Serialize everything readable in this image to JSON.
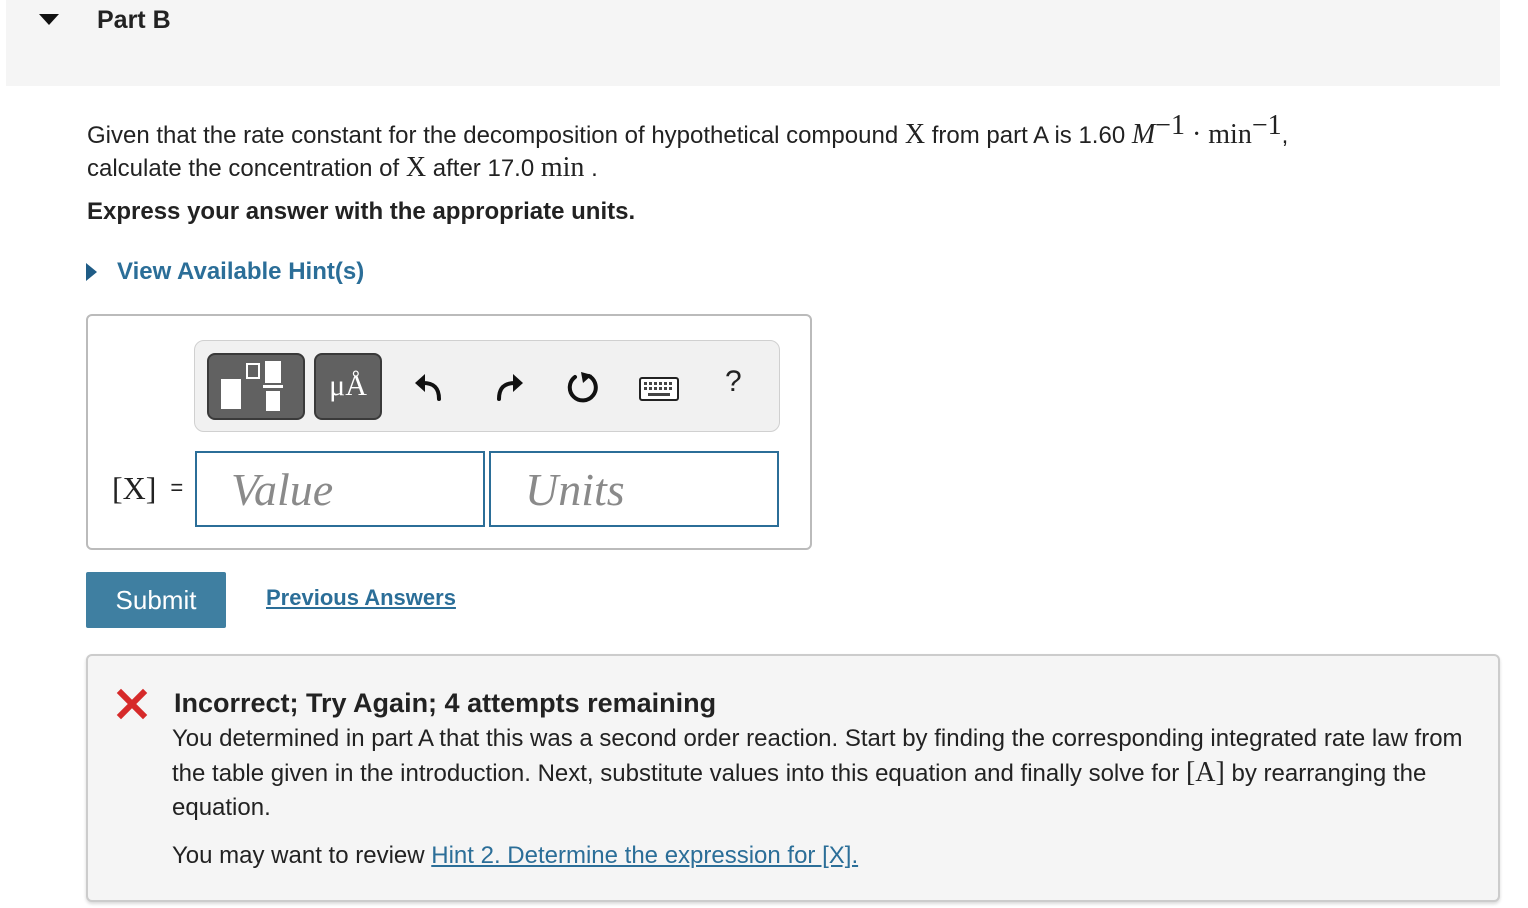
{
  "part": {
    "title": "Part B"
  },
  "question": {
    "t1": "Given that the rate constant for the decomposition of hypothetical compound ",
    "compound": "X",
    "t2": " from part A is 1.60 ",
    "unit1_base": "M",
    "unit1_exp": "−1",
    "dot": " · ",
    "unit2_base": "min",
    "unit2_exp": "−1",
    "t3": ",",
    "t4": "calculate the concentration of ",
    "compound2": "X",
    "t5": " after 17.0 ",
    "time_unit": "min",
    "t6": " ."
  },
  "instruction": "Express your answer with the appropriate units.",
  "hints": {
    "label": "View Available Hint(s)"
  },
  "toolbar": {
    "templates_icon": "fraction-template-icon",
    "units_label": "μÅ",
    "undo_icon": "undo-icon",
    "redo_icon": "redo-icon",
    "reset_icon": "reset-icon",
    "keyboard_icon": "keyboard-icon",
    "help_label": "?"
  },
  "answer": {
    "variable_label": "[X]",
    "equals": "=",
    "value_placeholder": "Value",
    "units_placeholder": "Units"
  },
  "actions": {
    "submit_label": "Submit",
    "previous_answers_label": "Previous Answers"
  },
  "feedback": {
    "icon": "x-mark-icon",
    "title": "Incorrect; Try Again; 4 attempts remaining",
    "body1": "You determined in part A that this was a second order reaction. Start by finding the corresponding integrated rate law from the table given in the introduction. Next, substitute values into this equation and finally solve for ",
    "body_math": "[A]",
    "body2": " by rearranging the equation.",
    "review_prefix": "You may want to review ",
    "review_link": "Hint 2. Determine the expression for [X]."
  },
  "colors": {
    "accent": "#2b6e98",
    "submit_bg": "#3f7fa1",
    "error_red": "#d62a2a",
    "toolbar_dark": "#616161"
  }
}
